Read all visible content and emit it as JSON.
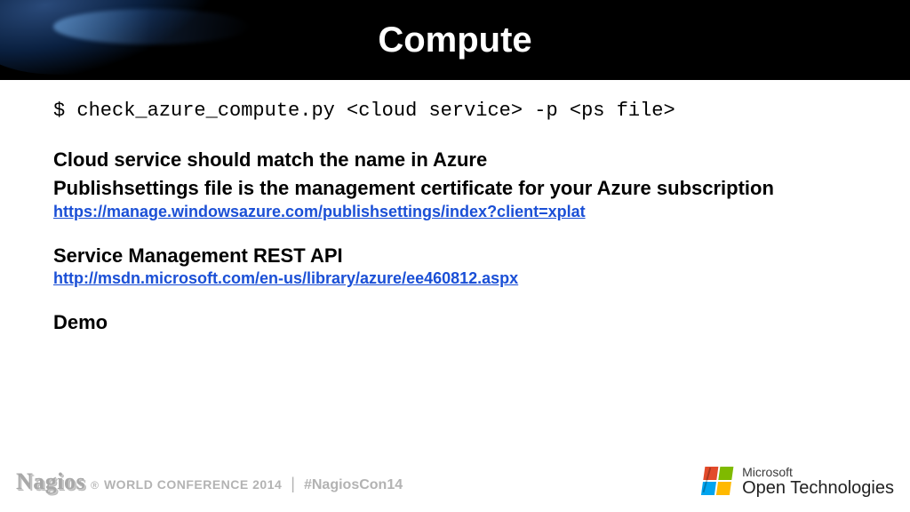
{
  "header": {
    "title": "Compute"
  },
  "content": {
    "command": "$ check_azure_compute.py <cloud service> -p <ps file>",
    "note1": "Cloud service should match the name in Azure",
    "note2": "Publishsettings file is the management certificate for your Azure subscription",
    "link1": "https://manage.windowsazure.com/publishsettings/index?client=xplat",
    "api_heading": "Service Management REST API",
    "link2": "http://msdn.microsoft.com/en-us/library/azure/ee460812.aspx",
    "demo": "Demo"
  },
  "footer": {
    "nagios": "Nagios",
    "reg": "®",
    "conference": "WORLD CONFERENCE 2014",
    "hashtag": "#NagiosCon14",
    "ms": "Microsoft",
    "ot": "Open Technologies"
  }
}
